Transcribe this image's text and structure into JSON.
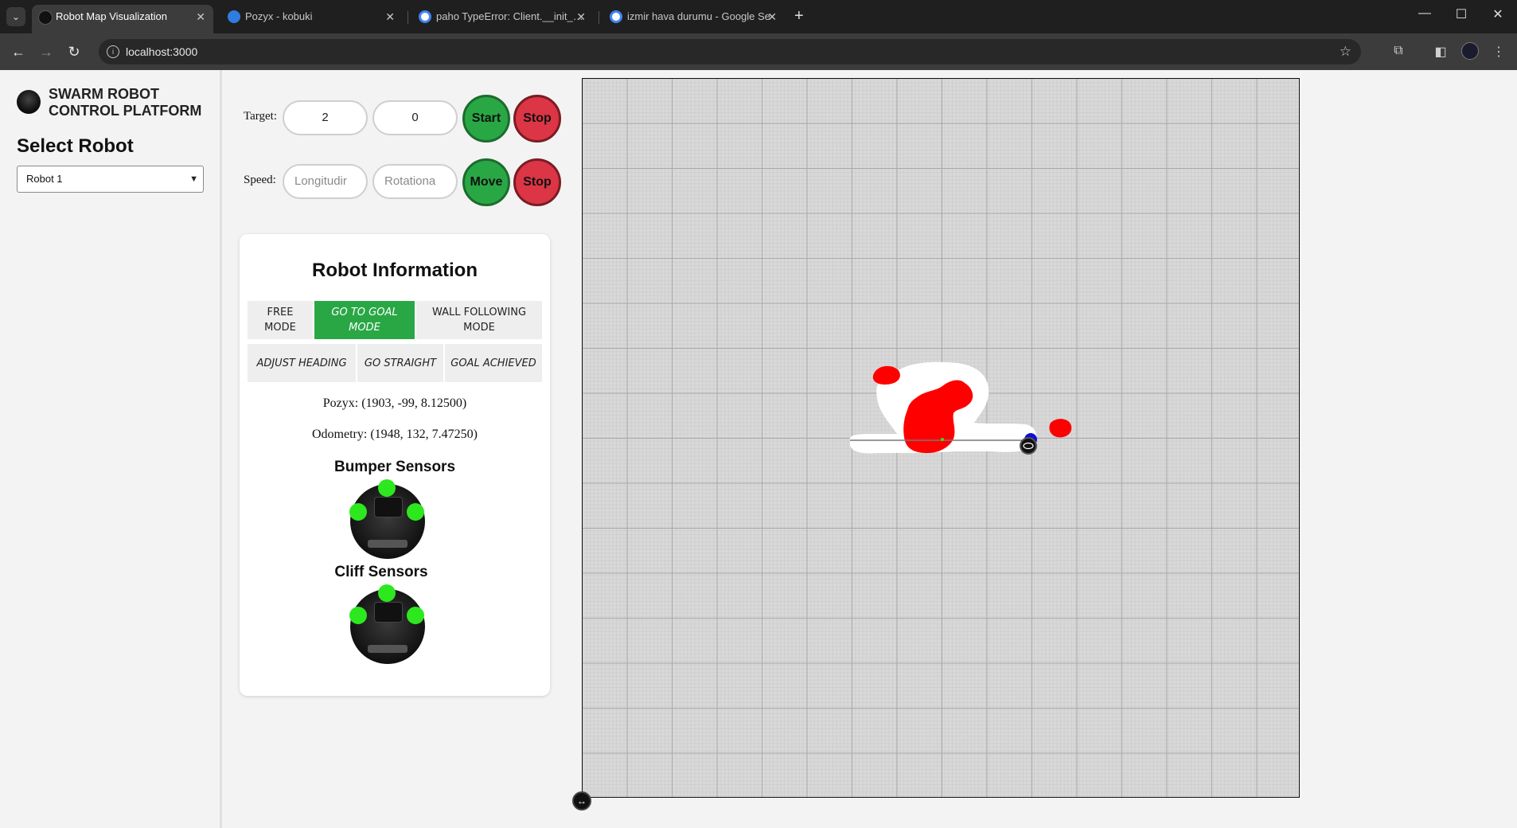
{
  "browser": {
    "tabs": [
      {
        "title": "Robot Map Visualization",
        "active": true,
        "favicon": "black-circle-icon"
      },
      {
        "title": "Pozyx - kobuki",
        "active": false,
        "favicon": "pozyx-icon"
      },
      {
        "title": "paho TypeError: Client.__init__()",
        "active": false,
        "favicon": "google-icon"
      },
      {
        "title": "izmir hava durumu - Google Se",
        "active": false,
        "favicon": "google-icon"
      }
    ],
    "url": "localhost:3000"
  },
  "sidebar": {
    "brand": "SWARM ROBOT CONTROL PLATFORM",
    "select_title": "Select Robot",
    "selected_robot": "Robot 1"
  },
  "controls": {
    "target_label": "Target:",
    "target_x": "2",
    "target_y": "0",
    "start_label": "Start",
    "stop_label": "Stop",
    "speed_label": "Speed:",
    "longitudinal_placeholder": "Longitudir",
    "rotational_placeholder": "Rotationa",
    "move_label": "Move",
    "stop2_label": "Stop"
  },
  "robot_info": {
    "title": "Robot Information",
    "modes": [
      "FREE MODE",
      "GO TO GOAL MODE",
      "WALL FOLLOWING MODE"
    ],
    "active_mode": "GO TO GOAL MODE",
    "states": [
      "ADJUST HEADING",
      "GO STRAIGHT",
      "GOAL ACHIEVED"
    ],
    "pozyx": "Pozyx: (1903, -99, 8.12500)",
    "odometry": "Odometry: (1948, 132, 7.47250)",
    "bumper_title": "Bumper Sensors",
    "cliff_title": "Cliff Sensors",
    "sensor_color": "#2de81e"
  },
  "colors": {
    "green": "#29a745",
    "red": "#dc3545",
    "obstacle": "#ff0000",
    "robot_marker": "#1010d0"
  }
}
